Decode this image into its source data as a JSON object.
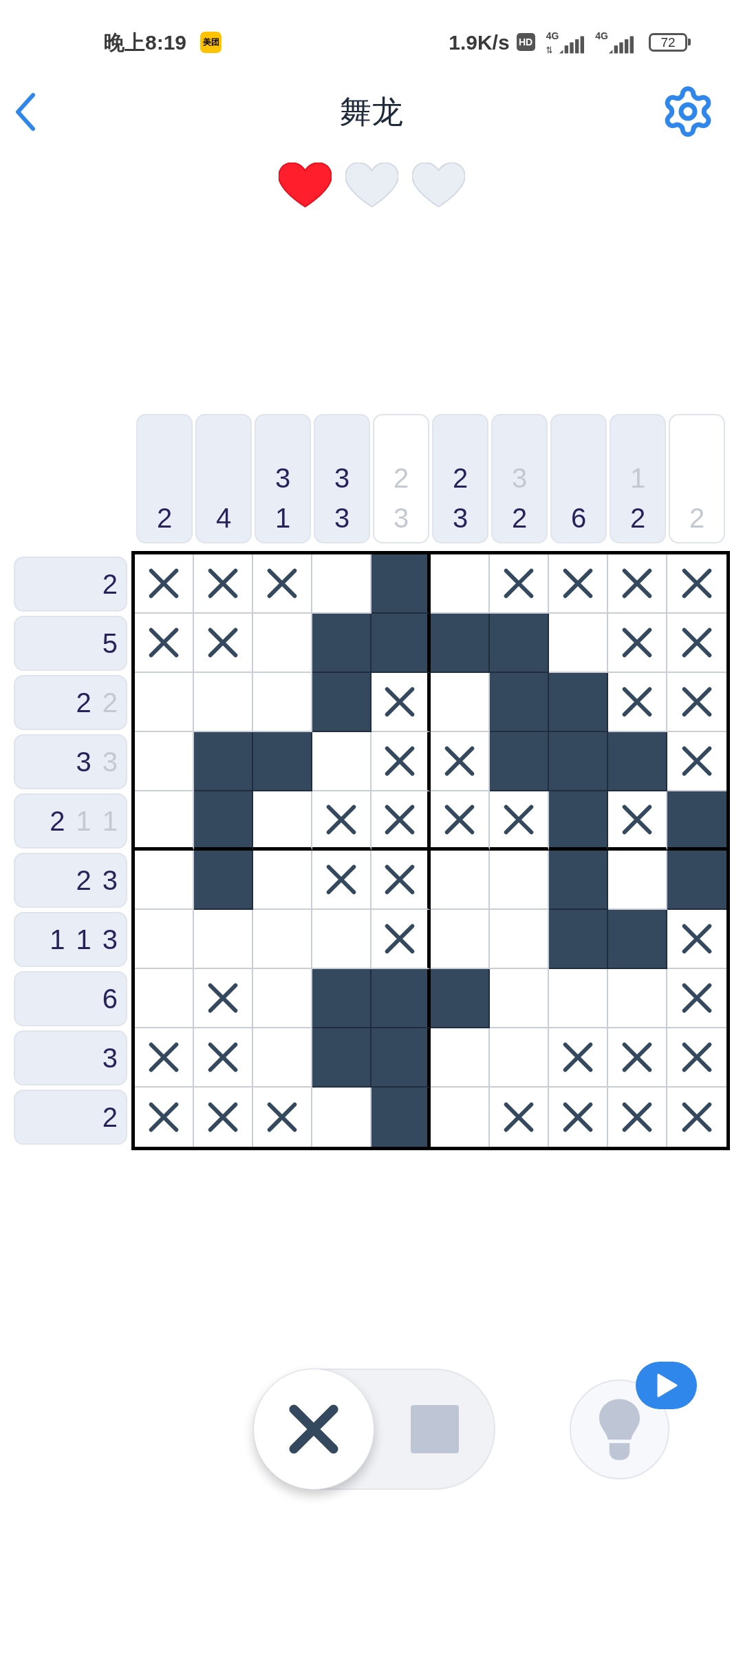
{
  "status_bar": {
    "time": "晚上8:19",
    "app_icon_label": "美团",
    "network_speed": "1.9K/s",
    "hd_label": "HD",
    "signals": [
      {
        "network": "4G",
        "data_arrows": true
      },
      {
        "network": "4G",
        "data_arrows": false
      }
    ],
    "battery": "72"
  },
  "header": {
    "title": "舞龙"
  },
  "lives": [
    {
      "filled": true
    },
    {
      "filled": false
    },
    {
      "filled": false
    }
  ],
  "column_clues": [
    {
      "completed": false,
      "numbers": [
        {
          "value": "2",
          "done": false
        }
      ]
    },
    {
      "completed": false,
      "numbers": [
        {
          "value": "4",
          "done": false
        }
      ]
    },
    {
      "completed": false,
      "numbers": [
        {
          "value": "3",
          "done": false
        },
        {
          "value": "1",
          "done": false
        }
      ]
    },
    {
      "completed": false,
      "numbers": [
        {
          "value": "3",
          "done": false
        },
        {
          "value": "3",
          "done": false
        }
      ]
    },
    {
      "completed": true,
      "numbers": [
        {
          "value": "2",
          "done": true
        },
        {
          "value": "3",
          "done": true
        }
      ]
    },
    {
      "completed": false,
      "numbers": [
        {
          "value": "2",
          "done": false
        },
        {
          "value": "3",
          "done": false
        }
      ]
    },
    {
      "completed": false,
      "numbers": [
        {
          "value": "3",
          "done": true
        },
        {
          "value": "2",
          "done": false
        }
      ]
    },
    {
      "completed": false,
      "numbers": [
        {
          "value": "6",
          "done": false
        }
      ]
    },
    {
      "completed": false,
      "numbers": [
        {
          "value": "1",
          "done": true
        },
        {
          "value": "2",
          "done": false
        }
      ]
    },
    {
      "completed": true,
      "numbers": [
        {
          "value": "2",
          "done": true
        }
      ]
    }
  ],
  "row_clues": [
    {
      "completed": false,
      "numbers": [
        {
          "value": "2",
          "done": false
        }
      ]
    },
    {
      "completed": false,
      "numbers": [
        {
          "value": "5",
          "done": false
        }
      ]
    },
    {
      "completed": false,
      "numbers": [
        {
          "value": "2",
          "done": false
        },
        {
          "value": "2",
          "done": true
        }
      ]
    },
    {
      "completed": false,
      "numbers": [
        {
          "value": "3",
          "done": false
        },
        {
          "value": "3",
          "done": true
        }
      ]
    },
    {
      "completed": false,
      "numbers": [
        {
          "value": "2",
          "done": false
        },
        {
          "value": "1",
          "done": true
        },
        {
          "value": "1",
          "done": true
        }
      ]
    },
    {
      "completed": false,
      "numbers": [
        {
          "value": "2",
          "done": false
        },
        {
          "value": "3",
          "done": false
        }
      ]
    },
    {
      "completed": false,
      "numbers": [
        {
          "value": "1",
          "done": false
        },
        {
          "value": "1",
          "done": false
        },
        {
          "value": "3",
          "done": false
        }
      ]
    },
    {
      "completed": false,
      "numbers": [
        {
          "value": "6",
          "done": false
        }
      ]
    },
    {
      "completed": false,
      "numbers": [
        {
          "value": "3",
          "done": false
        }
      ]
    },
    {
      "completed": false,
      "numbers": [
        {
          "value": "2",
          "done": false
        }
      ]
    }
  ],
  "grid": {
    "rows": [
      [
        {
          "kind": "cross"
        },
        {
          "kind": "cross"
        },
        {
          "kind": "cross"
        },
        {
          "kind": "empty"
        },
        {
          "kind": "filled"
        },
        {
          "kind": "empty"
        },
        {
          "kind": "cross"
        },
        {
          "kind": "cross"
        },
        {
          "kind": "cross"
        },
        {
          "kind": "cross"
        }
      ],
      [
        {
          "kind": "cross"
        },
        {
          "kind": "cross"
        },
        {
          "kind": "empty"
        },
        {
          "kind": "filled"
        },
        {
          "kind": "filled"
        },
        {
          "kind": "filled"
        },
        {
          "kind": "filled"
        },
        {
          "kind": "empty"
        },
        {
          "kind": "cross"
        },
        {
          "kind": "cross"
        }
      ],
      [
        {
          "kind": "empty"
        },
        {
          "kind": "empty"
        },
        {
          "kind": "empty"
        },
        {
          "kind": "filled"
        },
        {
          "kind": "cross"
        },
        {
          "kind": "empty"
        },
        {
          "kind": "filled"
        },
        {
          "kind": "filled"
        },
        {
          "kind": "cross"
        },
        {
          "kind": "cross"
        }
      ],
      [
        {
          "kind": "empty"
        },
        {
          "kind": "filled"
        },
        {
          "kind": "filled"
        },
        {
          "kind": "empty"
        },
        {
          "kind": "cross"
        },
        {
          "kind": "cross"
        },
        {
          "kind": "filled"
        },
        {
          "kind": "filled"
        },
        {
          "kind": "filled"
        },
        {
          "kind": "cross"
        }
      ],
      [
        {
          "kind": "empty"
        },
        {
          "kind": "filled"
        },
        {
          "kind": "empty"
        },
        {
          "kind": "cross"
        },
        {
          "kind": "cross"
        },
        {
          "kind": "cross"
        },
        {
          "kind": "cross"
        },
        {
          "kind": "filled"
        },
        {
          "kind": "cross"
        },
        {
          "kind": "filled"
        }
      ],
      [
        {
          "kind": "empty"
        },
        {
          "kind": "filled"
        },
        {
          "kind": "empty"
        },
        {
          "kind": "cross"
        },
        {
          "kind": "cross"
        },
        {
          "kind": "empty"
        },
        {
          "kind": "empty"
        },
        {
          "kind": "filled"
        },
        {
          "kind": "empty"
        },
        {
          "kind": "filled"
        }
      ],
      [
        {
          "kind": "empty"
        },
        {
          "kind": "empty"
        },
        {
          "kind": "empty"
        },
        {
          "kind": "empty"
        },
        {
          "kind": "cross"
        },
        {
          "kind": "empty"
        },
        {
          "kind": "empty"
        },
        {
          "kind": "filled"
        },
        {
          "kind": "filled"
        },
        {
          "kind": "cross"
        }
      ],
      [
        {
          "kind": "empty"
        },
        {
          "kind": "cross"
        },
        {
          "kind": "empty"
        },
        {
          "kind": "filled"
        },
        {
          "kind": "filled"
        },
        {
          "kind": "filled"
        },
        {
          "kind": "empty"
        },
        {
          "kind": "empty"
        },
        {
          "kind": "empty"
        },
        {
          "kind": "cross"
        }
      ],
      [
        {
          "kind": "cross"
        },
        {
          "kind": "cross"
        },
        {
          "kind": "empty"
        },
        {
          "kind": "filled"
        },
        {
          "kind": "filled"
        },
        {
          "kind": "empty"
        },
        {
          "kind": "empty"
        },
        {
          "kind": "cross"
        },
        {
          "kind": "cross"
        },
        {
          "kind": "cross"
        }
      ],
      [
        {
          "kind": "cross"
        },
        {
          "kind": "cross"
        },
        {
          "kind": "cross"
        },
        {
          "kind": "empty"
        },
        {
          "kind": "filled"
        },
        {
          "kind": "empty"
        },
        {
          "kind": "cross"
        },
        {
          "kind": "cross"
        },
        {
          "kind": "cross"
        },
        {
          "kind": "cross"
        }
      ]
    ]
  },
  "mode_toggle": {
    "options": [
      {
        "kind": "cross",
        "selected": true
      },
      {
        "kind": "fill",
        "selected": false
      }
    ]
  }
}
